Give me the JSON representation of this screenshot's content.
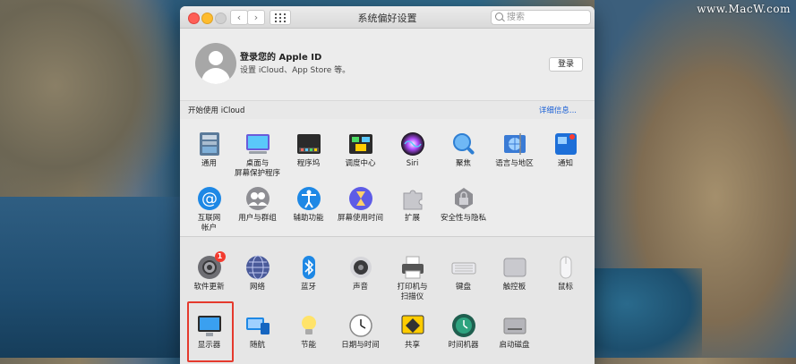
{
  "watermark": "www.MacW.com",
  "window": {
    "title": "系统偏好设置",
    "search_placeholder": "搜索",
    "nav_back": "‹",
    "nav_forward": "›"
  },
  "account": {
    "title": "登录您的 Apple ID",
    "subtitle": "设置 iCloud、App Store 等。",
    "login_label": "登录"
  },
  "icloud": {
    "label": "开始使用 iCloud",
    "details": "详细信息..."
  },
  "row1": [
    {
      "label": "通用",
      "icon": "general-icon"
    },
    {
      "label": "桌面与\n屏幕保护程序",
      "icon": "desktop-screensaver-icon"
    },
    {
      "label": "程序坞",
      "icon": "dock-icon"
    },
    {
      "label": "调度中心",
      "icon": "mission-control-icon"
    },
    {
      "label": "Siri",
      "icon": "siri-icon"
    },
    {
      "label": "聚焦",
      "icon": "spotlight-icon"
    },
    {
      "label": "语言与地区",
      "icon": "language-region-icon"
    },
    {
      "label": "通知",
      "icon": "notifications-icon"
    }
  ],
  "row2": [
    {
      "label": "互联网\n帐户",
      "icon": "internet-accounts-icon"
    },
    {
      "label": "用户与群组",
      "icon": "users-groups-icon"
    },
    {
      "label": "辅助功能",
      "icon": "accessibility-icon"
    },
    {
      "label": "屏幕使用时间",
      "icon": "screen-time-icon"
    },
    {
      "label": "扩展",
      "icon": "extensions-icon"
    },
    {
      "label": "安全性与隐私",
      "icon": "security-privacy-icon"
    }
  ],
  "row3": [
    {
      "label": "软件更新",
      "icon": "software-update-icon",
      "badge": "1"
    },
    {
      "label": "网络",
      "icon": "network-icon"
    },
    {
      "label": "蓝牙",
      "icon": "bluetooth-icon"
    },
    {
      "label": "声音",
      "icon": "sound-icon"
    },
    {
      "label": "打印机与\n扫描仪",
      "icon": "printers-scanners-icon"
    },
    {
      "label": "键盘",
      "icon": "keyboard-icon"
    },
    {
      "label": "触控板",
      "icon": "trackpad-icon"
    },
    {
      "label": "鼠标",
      "icon": "mouse-icon"
    }
  ],
  "row4": [
    {
      "label": "显示器",
      "icon": "displays-icon"
    },
    {
      "label": "随航",
      "icon": "sidecar-icon"
    },
    {
      "label": "节能",
      "icon": "energy-saver-icon"
    },
    {
      "label": "日期与时间",
      "icon": "date-time-icon"
    },
    {
      "label": "共享",
      "icon": "sharing-icon"
    },
    {
      "label": "时间机器",
      "icon": "time-machine-icon"
    },
    {
      "label": "启动磁盘",
      "icon": "startup-disk-icon"
    }
  ],
  "colors": {
    "highlight": "#e53a2d",
    "link": "#1d62d6",
    "badge": "#f33b2f"
  }
}
